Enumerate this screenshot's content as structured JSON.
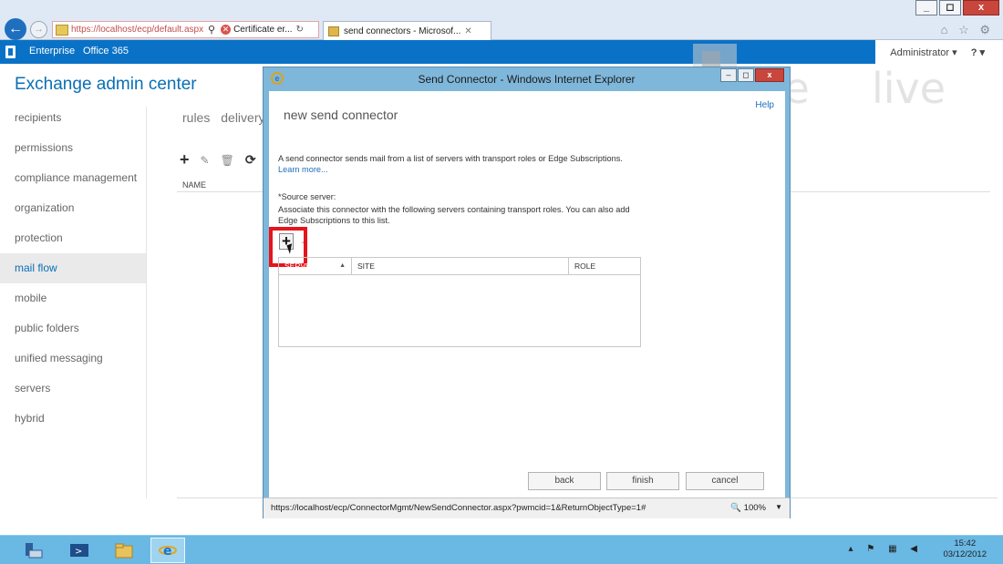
{
  "browser": {
    "url": "https://localhost/ecp/default.aspx",
    "cert_label": "Certificate er...",
    "tab_title": "send connectors - Microsof...",
    "window_buttons": [
      "_",
      "◻",
      "x"
    ],
    "chrome_icons": "⌂ ☆ ⚙"
  },
  "eac_header": {
    "enterprise": "Enterprise",
    "office365": "Office 365",
    "admin": "Administrator ▾",
    "help": "? ▾"
  },
  "eac": {
    "title": "Exchange admin center",
    "nav": [
      {
        "label": "recipients",
        "active": false
      },
      {
        "label": "permissions",
        "active": false
      },
      {
        "label": "compliance management",
        "active": false
      },
      {
        "label": "organization",
        "active": false
      },
      {
        "label": "protection",
        "active": false
      },
      {
        "label": "mail flow",
        "active": true
      },
      {
        "label": "mobile",
        "active": false
      },
      {
        "label": "public folders",
        "active": false
      },
      {
        "label": "unified messaging",
        "active": false
      },
      {
        "label": "servers",
        "active": false
      },
      {
        "label": "hybrid",
        "active": false
      }
    ],
    "subtabs": [
      "rules",
      "delivery"
    ],
    "toolbar": {
      "add": "+",
      "edit": "✎",
      "delete": "🗑",
      "refresh": "⟳"
    },
    "column_name": "NAME"
  },
  "watermark": {
    "word1": "pete",
    "word2": "live"
  },
  "popup": {
    "title": "Send Connector - Windows Internet Explorer",
    "buttons": {
      "min": "–",
      "max": "◻",
      "close": "x"
    },
    "help": "Help",
    "heading": "new send connector",
    "description": "A send connector sends mail from a list of servers with transport roles or Edge Subscriptions.",
    "learn_more": "Learn more...",
    "source_label": "*Source server:",
    "source_desc": "Associate this connector with the following servers containing transport roles. You can also add Edge Subscriptions to this list.",
    "add_symbol": "+",
    "remove_symbol": "–",
    "grid": {
      "columns": [
        "SERVER",
        "SITE",
        "ROLE"
      ],
      "sort_arrow": "▲"
    },
    "wizard": {
      "back": "back",
      "finish": "finish",
      "cancel": "cancel"
    },
    "status_url": "https://localhost/ecp/ConnectorMgmt/NewSendConnector.aspx?pwmcid=1&ReturnObjectType=1#",
    "zoom": "100%",
    "zoom_arrow": "▼"
  },
  "taskbar": {
    "clock_time": "15:42",
    "clock_date": "03/12/2012",
    "tray_icons": "▴ ⚑ ▦ ◀"
  }
}
